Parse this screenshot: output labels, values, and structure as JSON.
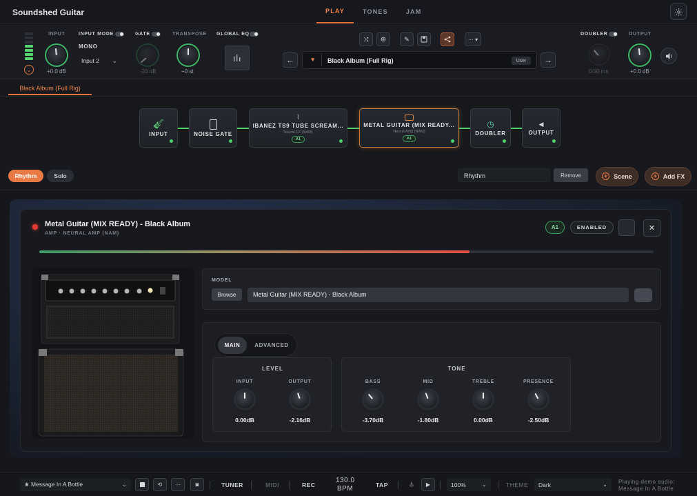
{
  "app": {
    "title": "Soundshed Guitar"
  },
  "tabs": [
    {
      "label": "PLAY"
    },
    {
      "label": "TONES"
    },
    {
      "label": "JAM"
    }
  ],
  "controls": {
    "input_label": "INPUT",
    "input_value": "+0.0 dB",
    "input_mode_label": "INPUT MODE",
    "mono_label": "MONO",
    "input_select": "Input 2",
    "gate_label": "GATE",
    "gate_value": "-20 dB",
    "transpose_label": "TRANSPOSE",
    "transpose_value": "+0 st",
    "global_eq_label": "GLOBAL EQ",
    "doubler_label": "DOUBLER",
    "doubler_value": "0.50 ms",
    "output_label": "OUTPUT",
    "output_value": "+0.0 dB"
  },
  "preset": {
    "name": "Black Album (Full Rig)",
    "badge": "User"
  },
  "chain_tab": "Black Album (Full Rig)",
  "chain": [
    {
      "title": "INPUT"
    },
    {
      "title": "NOISE GATE"
    },
    {
      "title": "IBANEZ TS9 TUBE SCREAM...",
      "subtitle": "Neural FX (NAM)",
      "badge": "A1"
    },
    {
      "title": "METAL GUITAR (MIX READY...",
      "subtitle": "Neural Amp (NAM)",
      "badge": "A1"
    },
    {
      "title": "DOUBLER"
    },
    {
      "title": "OUTPUT"
    }
  ],
  "scenes": {
    "rhythm": "Rhythm",
    "solo": "Solo",
    "scene_name": "Rhythm",
    "remove": "Remove",
    "scene_btn": "Scene",
    "add_fx": "Add FX"
  },
  "editor": {
    "title": "Metal Guitar (MIX READY) - Black Album",
    "subtitle": "AMP · NEURAL AMP (NAM)",
    "badge": "A1",
    "enabled": "ENABLED",
    "close": "✕",
    "progress": 0.7,
    "model_label": "MODEL",
    "browse": "Browse",
    "model_value": "Metal Guitar (MIX READY) - Black Album",
    "tab_main": "MAIN",
    "tab_advanced": "ADVANCED",
    "level_title": "LEVEL",
    "tone_title": "TONE",
    "level_params": [
      {
        "label": "INPUT",
        "value": "0.00dB",
        "angle": 0
      },
      {
        "label": "OUTPUT",
        "value": "-2.16dB",
        "angle": -18
      }
    ],
    "tone_params": [
      {
        "label": "BASS",
        "value": "-3.70dB",
        "angle": -40
      },
      {
        "label": "MID",
        "value": "-1.80dB",
        "angle": -20
      },
      {
        "label": "TREBLE",
        "value": "0.00dB",
        "angle": 0
      },
      {
        "label": "PRESENCE",
        "value": "-2.50dB",
        "angle": -28
      }
    ]
  },
  "bottom": {
    "song": "★ Message In A Bottle",
    "tuner": "TUNER",
    "midi": "MIDI",
    "rec": "REC",
    "bpm_value": "130.0",
    "bpm_label": "BPM",
    "tap": "TAP",
    "zoom": "100%",
    "theme_label": "THEME",
    "theme": "Dark",
    "status_line1": "Playing demo audio:",
    "status_line2": "Message In A Bottle"
  },
  "colors": {
    "accent": "#e8703c",
    "green": "#4bd06a",
    "led_red": "#e23b32"
  }
}
